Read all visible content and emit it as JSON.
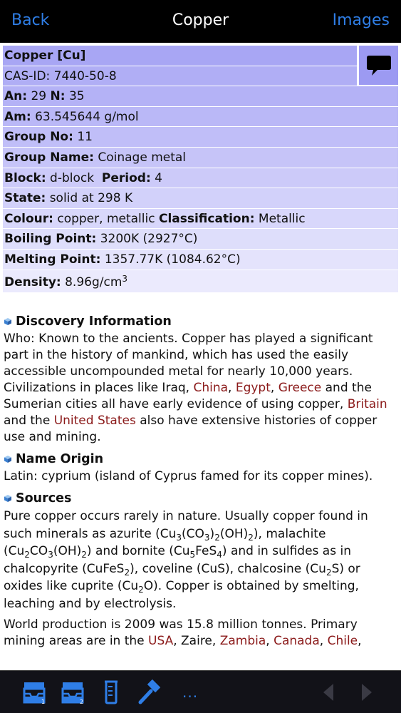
{
  "nav": {
    "back": "Back",
    "title": "Copper",
    "images": "Images"
  },
  "rows": [
    {
      "label": "Copper [Cu]",
      "value": ""
    },
    {
      "label": "",
      "value": "CAS-ID: 7440-50-8"
    },
    {
      "label": "An:",
      "value": " 29 ",
      "label2": "N:",
      "value2": " 35"
    },
    {
      "label": "Am:",
      "value": " 63.545644 g/mol"
    },
    {
      "label": "Group No:",
      "value": " 11"
    },
    {
      "label": "Group Name:",
      "value": " Coinage metal"
    },
    {
      "label": "Block:",
      "value": " d-block  ",
      "label2": "Period:",
      "value2": " 4"
    },
    {
      "label": "State:",
      "value": " solid at 298 K"
    },
    {
      "label": "Colour:",
      "value": " copper, metallic ",
      "label2": "Classification:",
      "value2": " Metallic"
    },
    {
      "label": "Boiling Point:",
      "value": " 3200K (2927°C)"
    },
    {
      "label": "Melting Point:",
      "value": " 1357.77K (1084.62°C)"
    },
    {
      "label": "Density:",
      "value": " 8.96g/cm",
      "sup": "3"
    }
  ],
  "row_colors": [
    "#a8a6f4",
    "#b0aef5",
    "#b4b2f6",
    "#bab8f7",
    "#c0bef8",
    "#c6c4f8",
    "#cccaf9",
    "#d2d1fa",
    "#d8d7fb",
    "#dedefb",
    "#e4e3fc",
    "#ebeafd"
  ],
  "sections": {
    "discovery": {
      "heading": "Discovery Information",
      "p1": "Who: Known to the ancients. Copper has played a significant part in the history of mankind, which has used the easily accessible uncompounded metal for nearly 10,000 years. Civilizations in places like Iraq, ",
      "l_china": "China",
      "sep1": ", ",
      "l_egypt": "Egypt",
      "sep2": ", ",
      "l_greece": "Greece",
      "p2": " and the Sumerian cities all have early evidence of using copper, ",
      "l_britain": "Britain",
      "p3": " and the ",
      "l_us": "United States",
      "p4": " also have extensive histories of copper use and mining."
    },
    "origin": {
      "heading": "Name Origin",
      "text": "Latin: cyprium (island of Cyprus famed for its copper mines)."
    },
    "sources": {
      "heading": "Sources",
      "t1": "Pure copper occurs rarely in nature. Usually copper found in such minerals as azurite (Cu",
      "t2": "(CO",
      "t3": ")",
      "t4": "(OH)",
      "t5": "), malachite (Cu",
      "t6": "CO",
      "t7": "(OH)",
      "t8": ") and bornite (Cu",
      "t9": "FeS",
      "t10": ") and in sulfides as in chalcopyrite (CuFeS",
      "t11": "), coveline (CuS), chalcosine (Cu",
      "t12": "S) or oxides like cuprite (Cu",
      "t13": "O). Copper is obtained by smelting, leaching and by electrolysis.",
      "s3": "3",
      "s2": "2",
      "s5": "5",
      "s4": "4",
      "w1": "World production is 2009 was 15.8 million tonnes. Primary mining areas are in the ",
      "l_usa": "USA",
      "w2": ", Zaire, ",
      "l_zambia": "Zambia",
      "w3": ", ",
      "l_canada": "Canada",
      "w4": ", ",
      "l_chile": "Chile",
      "w5": ","
    }
  },
  "tabbar": {
    "more": "..."
  },
  "colors": {
    "accent": "#2f7ee6",
    "link": "#8b1a1a",
    "navbar": "#000000",
    "tabbar": "#121218"
  }
}
